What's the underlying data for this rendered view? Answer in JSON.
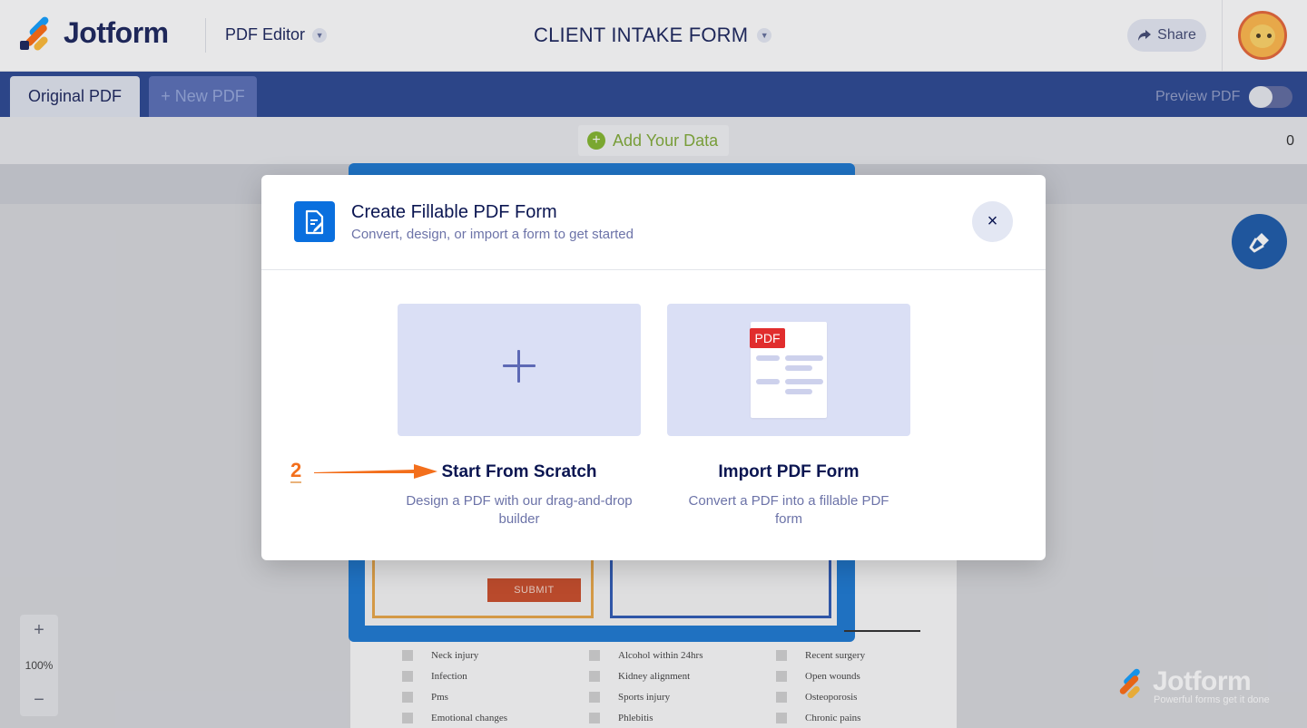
{
  "header": {
    "brand": "Jotform",
    "app_name": "PDF Editor",
    "form_title": "CLIENT INTAKE FORM",
    "share_label": "Share"
  },
  "tabs": {
    "original": "Original PDF",
    "new": "+ New PDF",
    "preview_label": "Preview PDF"
  },
  "toolbar": {
    "add_data_label": "Add Your Data",
    "count": "0"
  },
  "canvas": {
    "submit_label": "SUBMIT",
    "zoom_in": "+",
    "zoom_level": "100%",
    "zoom_out": "−",
    "checklist": [
      "Neck injury",
      "Alcohol within 24hrs",
      "Recent surgery",
      "Infection",
      "Kidney alignment",
      "Open wounds",
      "Pms",
      "Sports injury",
      "Osteoporosis",
      "Emotional changes",
      "Phlebitis",
      "Chronic pains"
    ],
    "footer_brand": "Jotform",
    "footer_tagline": "Powerful forms get it done"
  },
  "modal": {
    "title": "Create Fillable PDF Form",
    "subtitle": "Convert, design, or import a form to get started",
    "close_symbol": "×",
    "options": [
      {
        "title": "Start From Scratch",
        "description": "Design a PDF with our drag-and-drop builder"
      },
      {
        "title": "Import PDF Form",
        "description": "Convert a PDF into a fillable PDF form",
        "badge": "PDF"
      }
    ]
  },
  "annotation": {
    "step_number": "2",
    "color": "#f36f1c"
  },
  "colors": {
    "brand_navy": "#0a1551",
    "tab_bar": "#1b3a8a",
    "accent_blue": "#0a6fde",
    "option_card": "#dadff5",
    "add_data_green": "#7bb11f"
  }
}
